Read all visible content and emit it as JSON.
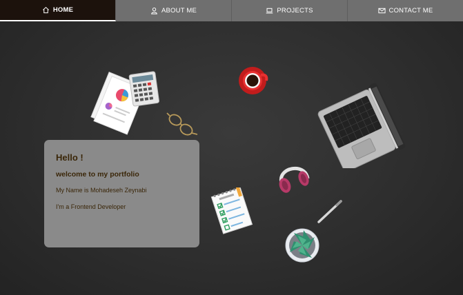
{
  "nav": {
    "items": [
      {
        "label": "HOME",
        "icon": "home-icon",
        "active": true
      },
      {
        "label": "ABOUT ME",
        "icon": "user-icon",
        "active": false
      },
      {
        "label": "PROJECTS",
        "icon": "laptop-icon",
        "active": false
      },
      {
        "label": "CONTACT ME",
        "icon": "envelope-icon",
        "active": false
      }
    ]
  },
  "intro": {
    "greeting": "Hello !",
    "welcome": "welcome to my portfolio",
    "name_line": "My Name is Mohadeseh Zeynabi",
    "role_line": "I'm a Frontend Developer"
  },
  "colors": {
    "nav_active_bg": "#1c120c",
    "nav_bg": "#6f6f6f",
    "card_bg": "#8a8a8a",
    "card_text": "#3a2608"
  }
}
